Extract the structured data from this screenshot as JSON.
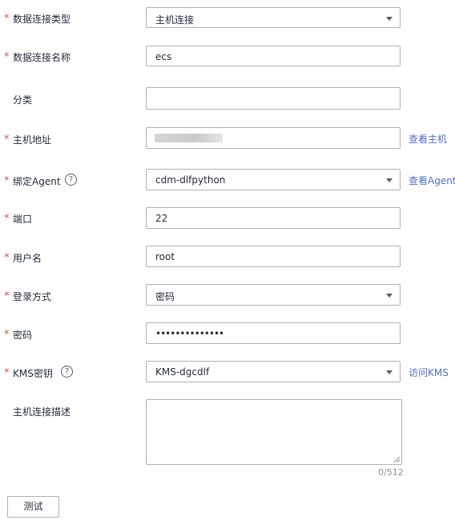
{
  "form": {
    "connection_type": {
      "label": "数据连接类型",
      "value": "主机连接",
      "required": true
    },
    "connection_name": {
      "label": "数据连接名称",
      "value": "ecs",
      "required": true
    },
    "category": {
      "label": "分类",
      "value": "",
      "required": false
    },
    "host_address": {
      "label": "主机地址",
      "value": "",
      "required": true,
      "link": "查看主机"
    },
    "bind_agent": {
      "label": "绑定Agent",
      "value": "cdm-dlfpython",
      "required": true,
      "link": "查看Agent",
      "help": "?"
    },
    "port": {
      "label": "端口",
      "value": "22",
      "required": true
    },
    "username": {
      "label": "用户名",
      "value": "root",
      "required": true
    },
    "login_method": {
      "label": "登录方式",
      "value": "密码",
      "required": true
    },
    "password": {
      "label": "密码",
      "value": "••••••••••••••",
      "required": true
    },
    "kms_key": {
      "label": "KMS密钥",
      "value": "KMS-dgcdlf",
      "required": true,
      "link": "访问KMS",
      "help": "?"
    },
    "description": {
      "label": "主机连接描述",
      "value": "",
      "required": false,
      "counter": "0/512"
    }
  },
  "required_mark": "*",
  "test_button": "测试",
  "colors": {
    "required": "#e84a4a",
    "link": "#526ecc",
    "border": "#adb0b8"
  }
}
